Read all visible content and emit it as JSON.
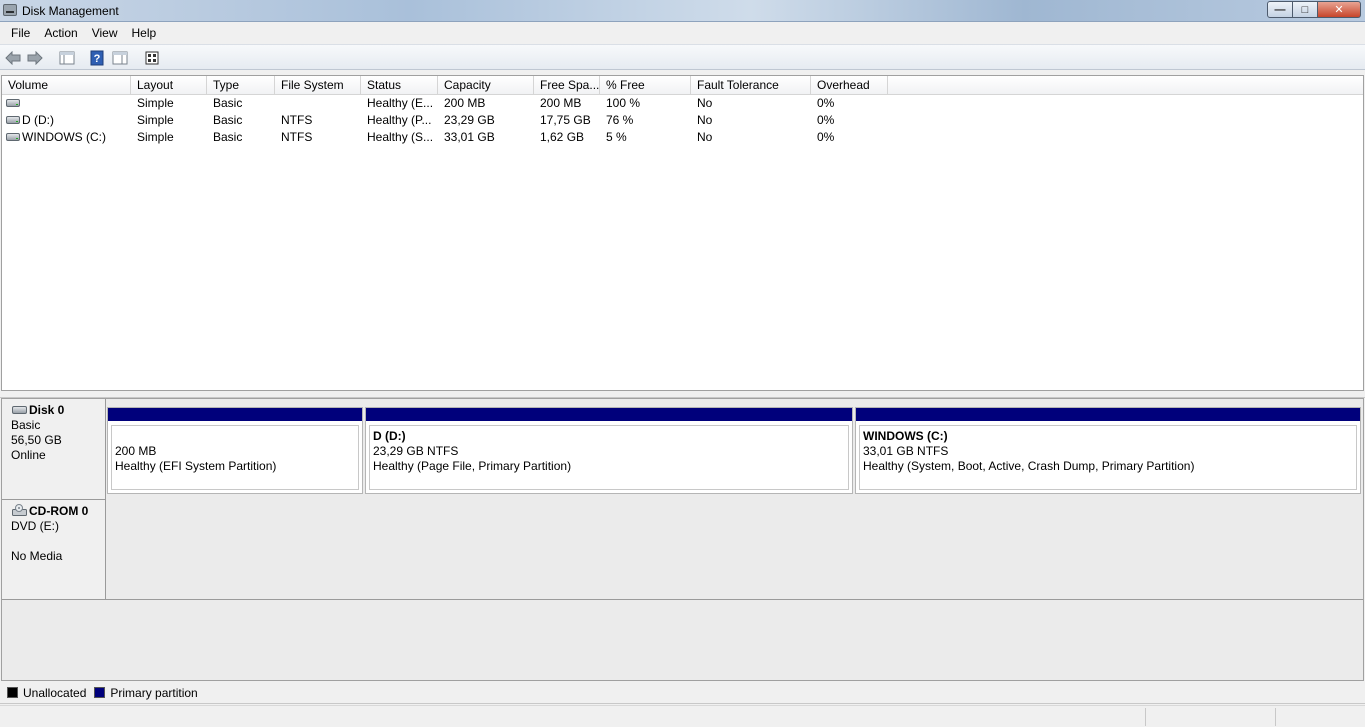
{
  "window": {
    "title": "Disk Management",
    "buttons": {
      "minimize": "—",
      "maximize": "□",
      "close": "✕"
    }
  },
  "menu": [
    "File",
    "Action",
    "View",
    "Help"
  ],
  "toolbar": [
    "back-arrow-icon",
    "forward-arrow-icon",
    "console-tree-icon",
    "help-icon",
    "properties-icon",
    "show-hide-action-pane-icon"
  ],
  "volume_list": {
    "columns": [
      "Volume",
      "Layout",
      "Type",
      "File System",
      "Status",
      "Capacity",
      "Free Spa...",
      "% Free",
      "Fault Tolerance",
      "Overhead"
    ],
    "rows": [
      [
        "",
        "Simple",
        "Basic",
        "",
        "Healthy (E...",
        "200 MB",
        "200 MB",
        "100 %",
        "No",
        "0%"
      ],
      [
        "D (D:)",
        "Simple",
        "Basic",
        "NTFS",
        "Healthy (P...",
        "23,29 GB",
        "17,75 GB",
        "76 %",
        "No",
        "0%"
      ],
      [
        "WINDOWS (C:)",
        "Simple",
        "Basic",
        "NTFS",
        "Healthy (S...",
        "33,01 GB",
        "1,62 GB",
        "5 %",
        "No",
        "0%"
      ]
    ]
  },
  "disks": [
    {
      "name": "Disk 0",
      "type": "Basic",
      "size": "56,50 GB",
      "state": "Online",
      "partitions": [
        {
          "name": "",
          "size": "200 MB",
          "status": "Healthy (EFI System Partition)"
        },
        {
          "name": "D  (D:)",
          "size": "23,29 GB NTFS",
          "status": "Healthy (Page File, Primary Partition)"
        },
        {
          "name": "WINDOWS  (C:)",
          "size": "33,01 GB NTFS",
          "status": "Healthy (System, Boot, Active, Crash Dump, Primary Partition)"
        }
      ]
    },
    {
      "name": "CD-ROM 0",
      "type": "DVD (E:)",
      "state": "No Media"
    }
  ],
  "legend": [
    {
      "label": "Unallocated",
      "color": "#000000"
    },
    {
      "label": "Primary partition",
      "color": "#00007b"
    }
  ]
}
